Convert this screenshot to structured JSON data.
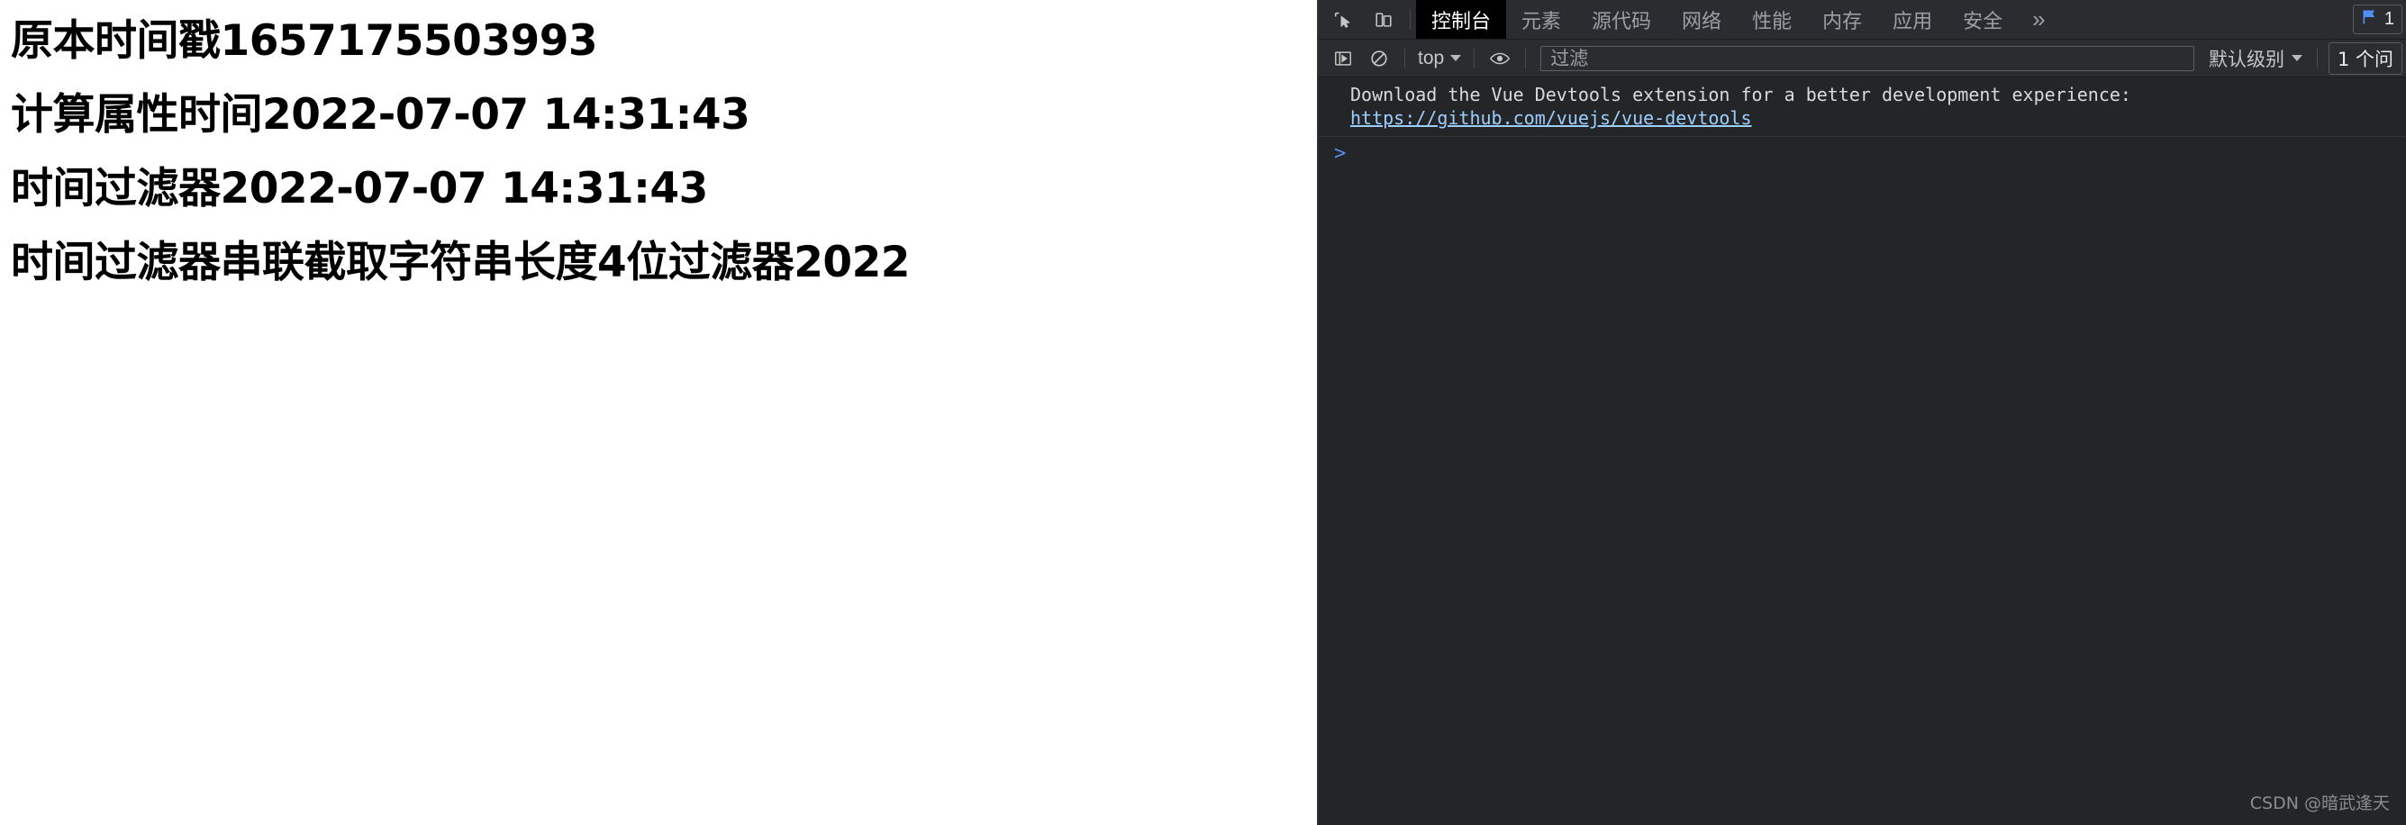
{
  "page": {
    "lines": [
      {
        "id": "original-timestamp",
        "text": "原本时间戳1657175503993"
      },
      {
        "id": "computed-property-time",
        "text": "计算属性时间2022-07-07 14:31:43"
      },
      {
        "id": "time-filter",
        "text": "时间过滤器2022-07-07 14:31:43"
      },
      {
        "id": "chained-filter",
        "text": "时间过滤器串联截取字符串长度4位过滤器2022"
      }
    ]
  },
  "devtools": {
    "icons": {
      "inspect": "inspect-element-icon",
      "device": "device-toolbar-icon",
      "more": "more-tabs-icon",
      "sidebar": "console-sidebar-icon",
      "clear": "clear-console-icon",
      "eye": "live-expression-icon",
      "issues_flag": "issues-flag-icon"
    },
    "tabs": [
      {
        "label": "控制台",
        "active": true
      },
      {
        "label": "元素",
        "active": false
      },
      {
        "label": "源代码",
        "active": false
      },
      {
        "label": "网络",
        "active": false
      },
      {
        "label": "性能",
        "active": false
      },
      {
        "label": "内存",
        "active": false
      },
      {
        "label": "应用",
        "active": false
      },
      {
        "label": "安全",
        "active": false
      }
    ],
    "more_tabs_label": "»",
    "tabbar_issue_label": "1",
    "toolbar": {
      "context_label": "top",
      "filter_placeholder": "过滤",
      "filter_value": "",
      "level_label": "默认级别",
      "issues_label": "1 个问"
    },
    "console": {
      "message_text": "Download the Vue Devtools extension for a better development experience:",
      "message_link": "https://github.com/vuejs/vue-devtools",
      "prompt_symbol": ">"
    },
    "watermark": "CSDN @暗武逢天",
    "colors": {
      "accent": "#5a8cf0",
      "panel_bg": "#242526",
      "toolbar_bg": "#2b2c2f",
      "active_tab_bg": "#000000",
      "link": "#9ccfff"
    }
  }
}
